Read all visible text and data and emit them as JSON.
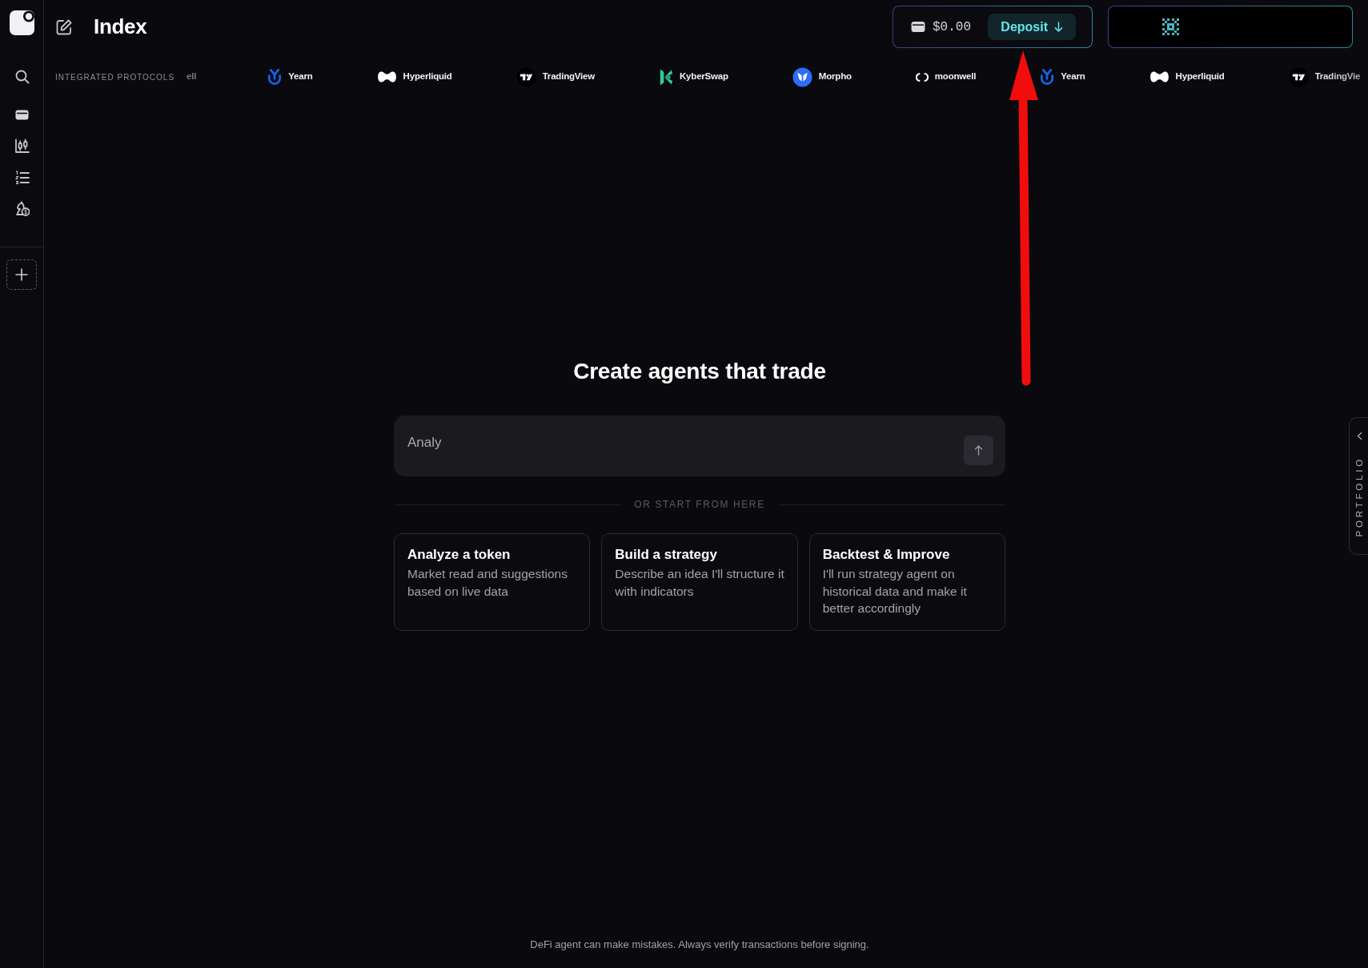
{
  "header": {
    "page_title": "Index",
    "balance": "$0.00",
    "deposit_button": "Deposit"
  },
  "protocols": {
    "label": "INTEGRATED PROTOCOLS",
    "items": [
      {
        "kind": "text",
        "name": "ell"
      },
      {
        "kind": "yearn",
        "name": "Yearn"
      },
      {
        "kind": "hyperliquid",
        "name": "Hyperliquid"
      },
      {
        "kind": "tradingview",
        "name": "TradingView"
      },
      {
        "kind": "kyberswap",
        "name": "KyberSwap"
      },
      {
        "kind": "morpho",
        "name": "Morpho"
      },
      {
        "kind": "moonwell",
        "name": "moonwell"
      },
      {
        "kind": "yearn",
        "name": "Yearn"
      },
      {
        "kind": "hyperliquid",
        "name": "Hyperliquid"
      },
      {
        "kind": "tradingview",
        "name": "TradingVie"
      }
    ]
  },
  "hero": {
    "title": "Create agents that trade",
    "prompt": {
      "placeholder": "Analy"
    },
    "divider_label": "OR START FROM HERE"
  },
  "suggestions": [
    {
      "title": "Analyze a token",
      "description": "Market read and suggestions based on live data"
    },
    {
      "title": "Build a strategy",
      "description": "Describe an idea I'll structure it with indicators"
    },
    {
      "title": "Backtest & Improve",
      "description": "I'll run strategy agent on historical data and make it better accordingly"
    }
  ],
  "portfolio_tab": {
    "label": "PORTFOLIO",
    "expanded": false
  },
  "footer": "DeFi agent can make mistakes. Always verify transactions before signing."
}
